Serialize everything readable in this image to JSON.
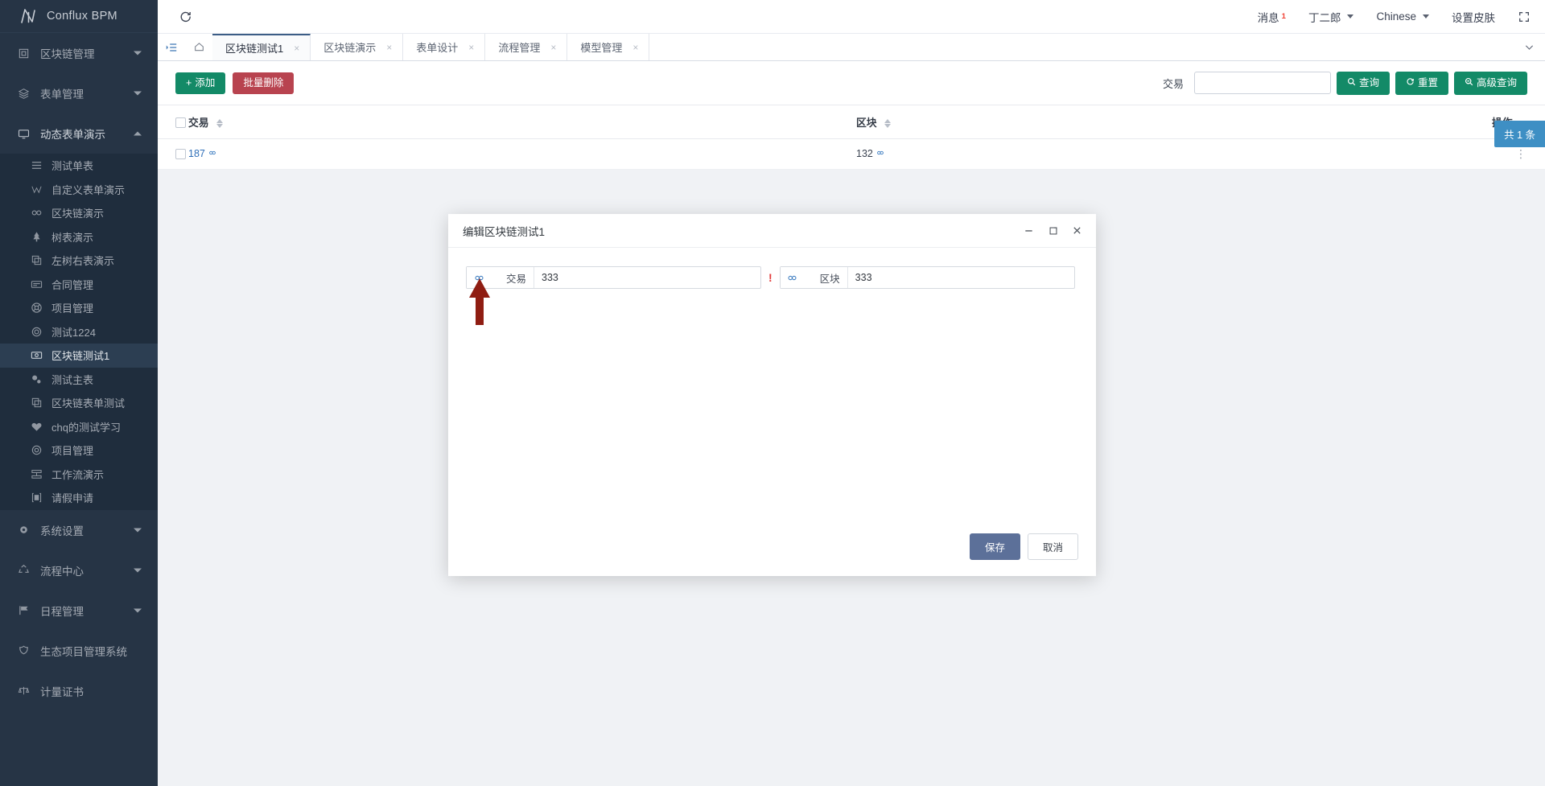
{
  "brand": {
    "name": "Conflux BPM",
    "logo_icon": "logo-n-icon"
  },
  "sidebar": {
    "groups": [
      {
        "label": "区块链管理",
        "icon": "blockchain-icon",
        "open": false
      },
      {
        "label": "表单管理",
        "icon": "form-icon",
        "open": false
      }
    ],
    "active_group": {
      "label": "动态表单演示",
      "icon": "monitor-icon"
    },
    "sub_items": [
      {
        "label": "测试单表",
        "icon": "list-icon",
        "active": false
      },
      {
        "label": "自定义表单演示",
        "icon": "w-letter-icon",
        "active": false
      },
      {
        "label": "区块链演示",
        "icon": "chain-icon",
        "active": false
      },
      {
        "label": "树表演示",
        "icon": "tree-icon",
        "active": false
      },
      {
        "label": "左树右表演示",
        "icon": "copy-icon",
        "active": false
      },
      {
        "label": "合同管理",
        "icon": "card-icon",
        "active": false
      },
      {
        "label": "项目管理",
        "icon": "lifebuoy-icon",
        "active": false
      },
      {
        "label": "测试1224",
        "icon": "circle-icon",
        "active": false
      },
      {
        "label": "区块链测试1",
        "icon": "id-card-icon",
        "active": true
      },
      {
        "label": "测试主表",
        "icon": "gears-icon",
        "active": false
      },
      {
        "label": "区块链表单测试",
        "icon": "copy-icon",
        "active": false
      },
      {
        "label": "chq的测试学习",
        "icon": "heart-icon",
        "active": false
      },
      {
        "label": "项目管理",
        "icon": "eye-icon",
        "active": false
      },
      {
        "label": "工作流演示",
        "icon": "flow-icon",
        "active": false
      },
      {
        "label": "请假申请",
        "icon": "leave-icon",
        "active": false
      }
    ],
    "bottom_groups": [
      {
        "label": "系统设置",
        "icon": "gear-icon",
        "caret": true
      },
      {
        "label": "流程中心",
        "icon": "recycle-icon",
        "caret": true
      },
      {
        "label": "日程管理",
        "icon": "flag-icon",
        "caret": true
      },
      {
        "label": "生态项目管理系统",
        "icon": "shield-icon",
        "caret": false
      },
      {
        "label": "计量证书",
        "icon": "scale-icon",
        "caret": false
      }
    ]
  },
  "navbar": {
    "refresh_icon": "refresh-icon",
    "messages_label": "消息",
    "messages_count": "1",
    "user_name": "丁二郎",
    "language": "Chinese",
    "theme_label": "设置皮肤",
    "fullscreen_icon": "fullscreen-icon"
  },
  "tabsbar": {
    "menu_icon": "indent-list-icon",
    "home_icon": "home-icon",
    "collapse_icon": "chevron-down-icon",
    "tabs": [
      {
        "label": "区块链测试1",
        "active": true
      },
      {
        "label": "区块链演示",
        "active": false
      },
      {
        "label": "表单设计",
        "active": false
      },
      {
        "label": "流程管理",
        "active": false
      },
      {
        "label": "模型管理",
        "active": false
      }
    ],
    "close_glyph": "×"
  },
  "toolbar": {
    "add_label": "添加",
    "add_icon": "plus-icon",
    "delete_label": "批量删除",
    "search_field_label": "交易",
    "search_value": "",
    "search_placeholder": "",
    "query_label": "查询",
    "query_icon": "search-icon",
    "reset_label": "重置",
    "reset_icon": "refresh-icon",
    "adv_label": "高级查询",
    "adv_icon": "search-minus-icon"
  },
  "table": {
    "columns": [
      {
        "label": "交易",
        "sortable": true
      },
      {
        "label": "区块",
        "sortable": true
      },
      {
        "label": "操作",
        "sortable": false
      }
    ],
    "rows": [
      {
        "trade": "187",
        "block": "132",
        "trade_icon": "chain-icon",
        "block_icon": "chain-icon",
        "more_glyph": "⋮"
      }
    ],
    "total_badge": "共 1 条"
  },
  "modal": {
    "title": "编辑区块链测试1",
    "minimize_icon": "minimize-icon",
    "maximize_icon": "maximize-icon",
    "close_icon": "close-icon",
    "fields": [
      {
        "label": "交易",
        "value": "333",
        "icon": "chain-icon",
        "warning": "!"
      },
      {
        "label": "区块",
        "value": "333",
        "icon": "chain-icon",
        "warning": ""
      }
    ],
    "save_label": "保存",
    "cancel_label": "取消"
  },
  "annotation": {
    "arrow_color": "#8f1d12",
    "arrow_icon": "up-arrow-annotation"
  }
}
